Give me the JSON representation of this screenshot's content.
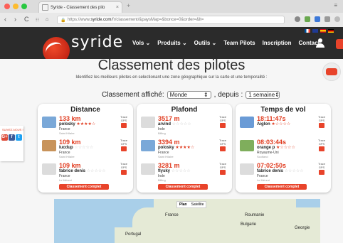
{
  "browser": {
    "tab_title": "Syride - Classement des pilo",
    "new_tab": "+",
    "url_prefix": "https://www.",
    "url_domain": "syride.com",
    "url_rest": "/fr/classement/&paysMap=&bonce=0&order=&lt=",
    "traffic_colors": [
      "#fc5f57",
      "#fdbc2e",
      "#28c840"
    ]
  },
  "site": {
    "logo_text": "syride",
    "nav": [
      "Vols",
      "Produits",
      "Outils",
      "Team Pilots",
      "Inscription",
      "Contact"
    ],
    "nav_dropdown": [
      true,
      true,
      true,
      false,
      false,
      false
    ],
    "accent_color": "#e8432a"
  },
  "page": {
    "title": "Classement des pilotes",
    "subtitle": "Identifiez les meilleurs pilotes en selectionant une zone géographique sur la carte et une temporalité :",
    "classement_label": "Classement affiché:",
    "classement_value": "Monde",
    "depuis_label": ", depuis :",
    "depuis_value": "1 semaine"
  },
  "share": {
    "label": "SUIVEZ-NOUS !",
    "buttons": [
      {
        "icon": "google-plus-icon",
        "glyph": "G+",
        "color": "#dd4b39"
      },
      {
        "icon": "facebook-icon",
        "glyph": "f",
        "color": "#3b5998"
      },
      {
        "icon": "twitter-icon",
        "glyph": "t",
        "color": "#1da1f2"
      }
    ]
  },
  "trace_label": [
    "Trace",
    "GPS"
  ],
  "button_complet": "Classement complet",
  "cards": [
    {
      "title": "Distance",
      "entries": [
        {
          "value": "133 km",
          "name": "polosky",
          "stars": 4,
          "country": "France",
          "city": "Saint Hilaire",
          "thumb": "#7aa8d8"
        },
        {
          "value": "109 km",
          "name": "lucdup",
          "stars": 0,
          "country": "France",
          "city": "Saint Hilaire",
          "thumb": "#c8935a"
        },
        {
          "value": "109 km",
          "name": "fabrice denis",
          "stars": 0,
          "country": "France",
          "city": "Le Mérzut",
          "thumb": "#dcdcdc"
        }
      ]
    },
    {
      "title": "Plafond",
      "entries": [
        {
          "value": "3517 m",
          "name": "arvind",
          "stars": 0,
          "country": "Inde",
          "city": "Billing",
          "thumb": "#dcdcdc"
        },
        {
          "value": "3394 m",
          "name": "polosky",
          "stars": 4,
          "country": "France",
          "city": "Saint Hilaire",
          "thumb": "#7aa8d8"
        },
        {
          "value": "3281 m",
          "name": "flysky",
          "stars": 0,
          "country": "Inde",
          "city": "Billing",
          "thumb": "#dcdcdc"
        }
      ]
    },
    {
      "title": "Temps de vol",
      "entries": [
        {
          "value": "18:11:47s",
          "name": "Aiglon",
          "stars": 1,
          "country": "",
          "city": "",
          "thumb": "#6a9bd6"
        },
        {
          "value": "08:03:44s",
          "name": "orange p",
          "stars": 1,
          "country": "Royaume-Uni",
          "city": "Scotland",
          "thumb": "#7fae5c"
        },
        {
          "value": "07:02:50s",
          "name": "fabrice denis",
          "stars": 0,
          "country": "France",
          "city": "Le Mérzut",
          "thumb": "#dcdcdc"
        }
      ]
    }
  ],
  "map": {
    "controls": [
      "Plan",
      "Satellite"
    ],
    "labels": [
      "France",
      "Roumanie",
      "Bulgarie",
      "Portugal",
      "Georgie"
    ]
  }
}
